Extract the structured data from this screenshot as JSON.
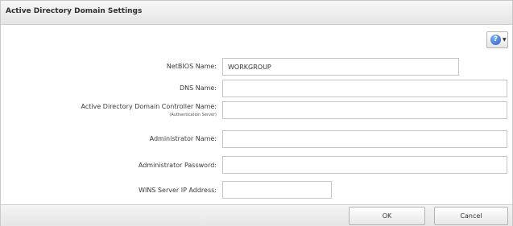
{
  "dialog": {
    "title": "Active Directory Domain Settings"
  },
  "help": {
    "icon": "help-icon",
    "glyph": "?",
    "caret": "▼"
  },
  "fields": {
    "netbios": {
      "label": "NetBIOS Name:",
      "value": "WORKGROUP"
    },
    "dns": {
      "label": "DNS Name:",
      "value": ""
    },
    "ad_controller": {
      "label": "Active Directory Domain Controller Name:",
      "sublabel": "(Authentication Server)",
      "value": ""
    },
    "admin_name": {
      "label": "Administrator Name:",
      "value": ""
    },
    "admin_password": {
      "label": "Administrator Password:",
      "value": ""
    },
    "wins": {
      "label": "WINS Server IP Address:",
      "value": ""
    }
  },
  "buttons": {
    "ok": "OK",
    "cancel": "Cancel"
  }
}
